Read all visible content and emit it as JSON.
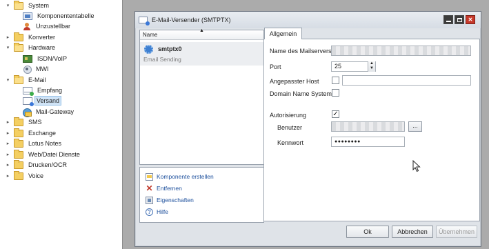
{
  "tree": {
    "items": [
      {
        "label": "System",
        "icon": "folder-open-icon",
        "expander": "▾"
      },
      {
        "label": "Komponententabelle",
        "icon": "table-app-icon",
        "expander": ""
      },
      {
        "label": "Unzustellbar",
        "icon": "person-icon",
        "expander": ""
      },
      {
        "label": "Konverter",
        "icon": "folder-icon",
        "expander": "▸"
      },
      {
        "label": "Hardware",
        "icon": "folder-open-icon",
        "expander": "▾"
      },
      {
        "label": "ISDN/VoIP",
        "icon": "isdn-card-icon",
        "expander": ""
      },
      {
        "label": "MWI",
        "icon": "mwi-icon",
        "expander": ""
      },
      {
        "label": "E-Mail",
        "icon": "folder-open-icon",
        "expander": "▾"
      },
      {
        "label": "Empfang",
        "icon": "mail-receive-icon",
        "expander": ""
      },
      {
        "label": "Versand",
        "icon": "mail-send-icon",
        "expander": ""
      },
      {
        "label": "Mail-Gateway",
        "icon": "mail-gateway-icon",
        "expander": ""
      },
      {
        "label": "SMS",
        "icon": "folder-icon",
        "expander": "▸"
      },
      {
        "label": "Exchange",
        "icon": "folder-icon",
        "expander": "▸"
      },
      {
        "label": "Lotus Notes",
        "icon": "folder-icon",
        "expander": "▸"
      },
      {
        "label": "Web/Datei Dienste",
        "icon": "folder-icon",
        "expander": "▸"
      },
      {
        "label": "Drucken/OCR",
        "icon": "folder-icon",
        "expander": "▸"
      },
      {
        "label": "Voice",
        "icon": "folder-icon",
        "expander": "▸"
      }
    ],
    "selected": "Versand"
  },
  "dialog": {
    "title": "E-Mail-Versender (SMTPTX)",
    "list": {
      "column_header": "Name",
      "sort_indicator": "▲",
      "item_name": "smtptx0",
      "item_description": "Email Sending"
    },
    "actions": [
      {
        "label": "Komponente erstellen",
        "icon": "new-component-icon"
      },
      {
        "label": "Entfernen",
        "icon": "delete-icon"
      },
      {
        "label": "Eigenschaften",
        "icon": "properties-icon"
      },
      {
        "label": "Hilfe",
        "icon": "help-icon"
      }
    ],
    "tab": "Allgemein",
    "form": {
      "mailserver_label": "Name des Mailservers",
      "mailserver_value": "",
      "port_label": "Port",
      "port_value": "25",
      "host_label": "Angepasster Host",
      "host_checked": false,
      "host_value": "",
      "dns_label": "Domain Name System",
      "dns_checked": false,
      "auth_label": "Autorisierung",
      "auth_checked": true,
      "user_label": "Benutzer",
      "user_value": "",
      "browse_label": "...",
      "password_label": "Kennwort",
      "password_value": "●●●●●●●●"
    },
    "buttons": {
      "ok": "Ok",
      "cancel": "Abbrechen",
      "apply": "Übernehmen"
    }
  },
  "colors": {
    "workspace": "#ababab",
    "selection": "#cfe3f6",
    "close_button": "#c6392b",
    "link": "#1c4f9c"
  }
}
